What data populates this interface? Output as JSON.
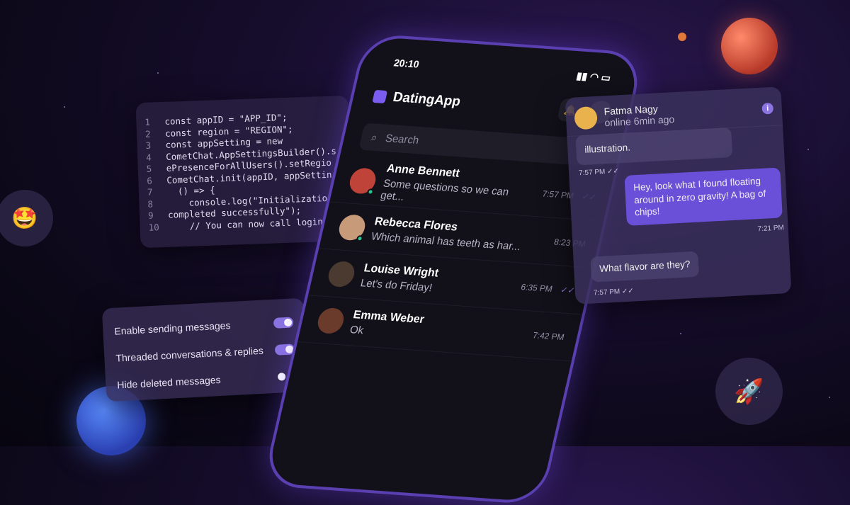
{
  "code": {
    "lines": [
      {
        "n": "1",
        "text": "const appID = \"APP_ID\";"
      },
      {
        "n": "2",
        "text": "const region = \"REGION\";"
      },
      {
        "n": "3",
        "text": "const appSetting = new"
      },
      {
        "n": "4",
        "text": "CometChat.AppSettingsBuilder().s"
      },
      {
        "n": "5",
        "text": "ePresenceForAllUsers().setRegio"
      },
      {
        "n": "6",
        "text": "CometChat.init(appID, appSettin"
      },
      {
        "n": "7",
        "text": "  () => {"
      },
      {
        "n": "8",
        "text": "    console.log(\"Initializatio"
      },
      {
        "n": "9",
        "text": "completed successfully\");"
      },
      {
        "n": "10",
        "text": "    // You can now call login"
      }
    ]
  },
  "settings": [
    {
      "label": "Enable sending messages",
      "on": true
    },
    {
      "label": "Threaded conversations & replies",
      "on": true
    },
    {
      "label": "Hide deleted messages",
      "on": false
    }
  ],
  "phone": {
    "time": "20:10",
    "app_name": "DatingApp",
    "search_placeholder": "Search",
    "conversations": [
      {
        "name": "Anne Bennett",
        "message": "Some questions so we can get...",
        "time": "7:57 PM",
        "online": true,
        "read": true,
        "avatar": "#c0433a"
      },
      {
        "name": "Rebecca Flores",
        "message": "Which animal has teeth as har...",
        "time": "8:23 PM",
        "online": true,
        "read": false,
        "avatar": "#c79a7a"
      },
      {
        "name": "Louise Wright",
        "message": "Let's do Friday!",
        "time": "6:35 PM",
        "online": false,
        "read": true,
        "avatar": "#4a3a30"
      },
      {
        "name": "Emma Weber",
        "message": "Ok",
        "time": "7:42 PM",
        "online": false,
        "read": false,
        "avatar": "#6a3a2a"
      }
    ]
  },
  "chat": {
    "name": "Fatma Nagy",
    "status": "online 6min ago",
    "m1": "illustration.",
    "t1": "7:57 PM ✓✓",
    "m2": "Hey, look what I found floating around in zero gravity! A bag of chips!",
    "t2": "7:21 PM",
    "m3": "What flavor are they?",
    "t3": "7:57 PM ✓✓"
  },
  "emojis": {
    "left": "🤩",
    "right": "🚀"
  },
  "colors": {
    "accent": "#7b5cf0",
    "bubble": "#6a50d8"
  }
}
